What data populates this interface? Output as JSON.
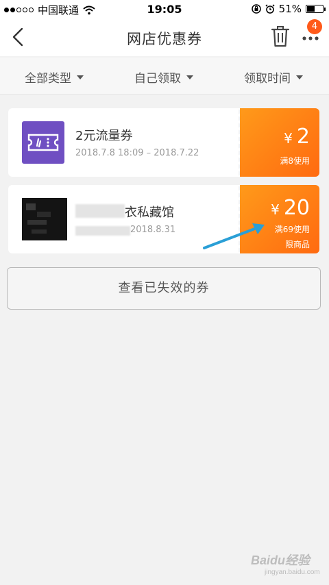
{
  "status_bar": {
    "carrier": "中国联通",
    "time": "19:05",
    "battery": "51%",
    "signal_bars_filled": 2,
    "signal_bars_total": 5,
    "battery_level": 0.51
  },
  "nav": {
    "title": "网店优惠券",
    "badge_count": "4",
    "icons": [
      "back-arrow-icon",
      "trash-icon",
      "more-icon"
    ]
  },
  "filters": [
    {
      "label": "全部类型"
    },
    {
      "label": "自己领取"
    },
    {
      "label": "领取时间"
    }
  ],
  "coupons": [
    {
      "name": "2元流量券",
      "date": "2018.7.8 18:09 – 2018.7.22",
      "currency": "¥",
      "value": "2",
      "condition": "满8使用",
      "limit": ""
    },
    {
      "name": "衣私藏馆",
      "date": "2018.8.31",
      "currency": "¥",
      "value": "20",
      "condition": "满69使用",
      "limit": "限商品"
    }
  ],
  "expired_button": {
    "label": "查看已失效的券"
  },
  "watermark": {
    "text": "Baidu经验",
    "subtext": "jingyan.baidu.com"
  },
  "colors": {
    "accent_orange": "#ff7a12",
    "purple_icon": "#6f4fc2",
    "badge": "#ff5a1a",
    "annotation_arrow": "#2a9fd6"
  }
}
